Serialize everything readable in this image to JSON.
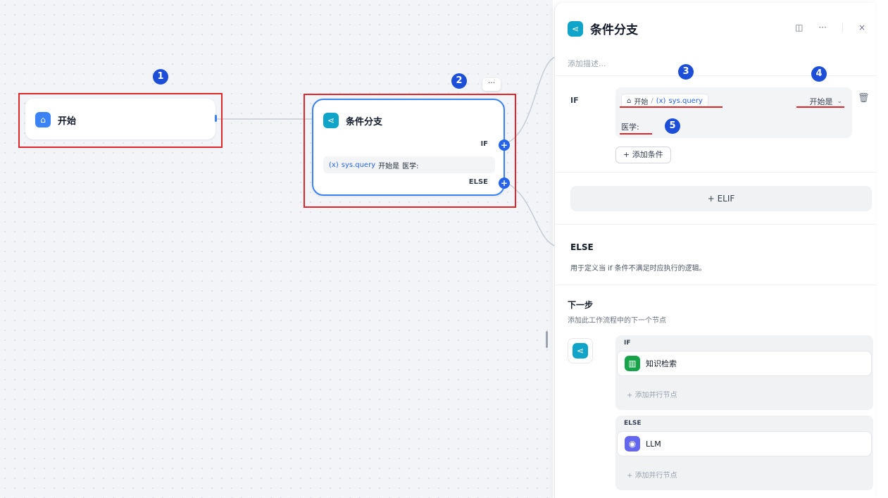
{
  "canvas": {
    "start_node": {
      "title": "开始"
    },
    "condition_node": {
      "title": "条件分支",
      "if_label": "IF",
      "else_label": "ELSE",
      "condition_var": "sys.query",
      "condition_var_prefix": "(x)",
      "condition_op": "开始是",
      "condition_value": "医学:",
      "more_label": "···"
    },
    "badges": [
      "1",
      "2",
      "3",
      "4",
      "5"
    ]
  },
  "panel": {
    "title": "条件分支",
    "description_placeholder": "添加描述...",
    "tools": {
      "split": "◫",
      "more": "···",
      "close": "×"
    },
    "if_section": {
      "label": "IF",
      "var_source": "开始",
      "var_prefix": "(x)",
      "var_name": "sys.query",
      "separator": "/",
      "operator": "开始是",
      "value": "医学:",
      "add_condition": "+ 添加条件"
    },
    "elif_button": "+ ELIF",
    "else_section": {
      "title": "ELSE",
      "description": "用于定义当 if 条件不满足时应执行的逻辑。"
    },
    "next_step": {
      "title": "下一步",
      "description": "添加此工作流程中的下一个节点",
      "branches": [
        {
          "label": "IF",
          "node": "知识检索",
          "add": "+ 添加并行节点"
        },
        {
          "label": "ELSE",
          "node": "LLM",
          "add": "+ 添加并行节点"
        }
      ]
    }
  },
  "colors": {
    "accent": "#3b82f6",
    "annotation": "#e0262b",
    "badge": "#1d4ed8",
    "teal": "#10a5c8"
  }
}
